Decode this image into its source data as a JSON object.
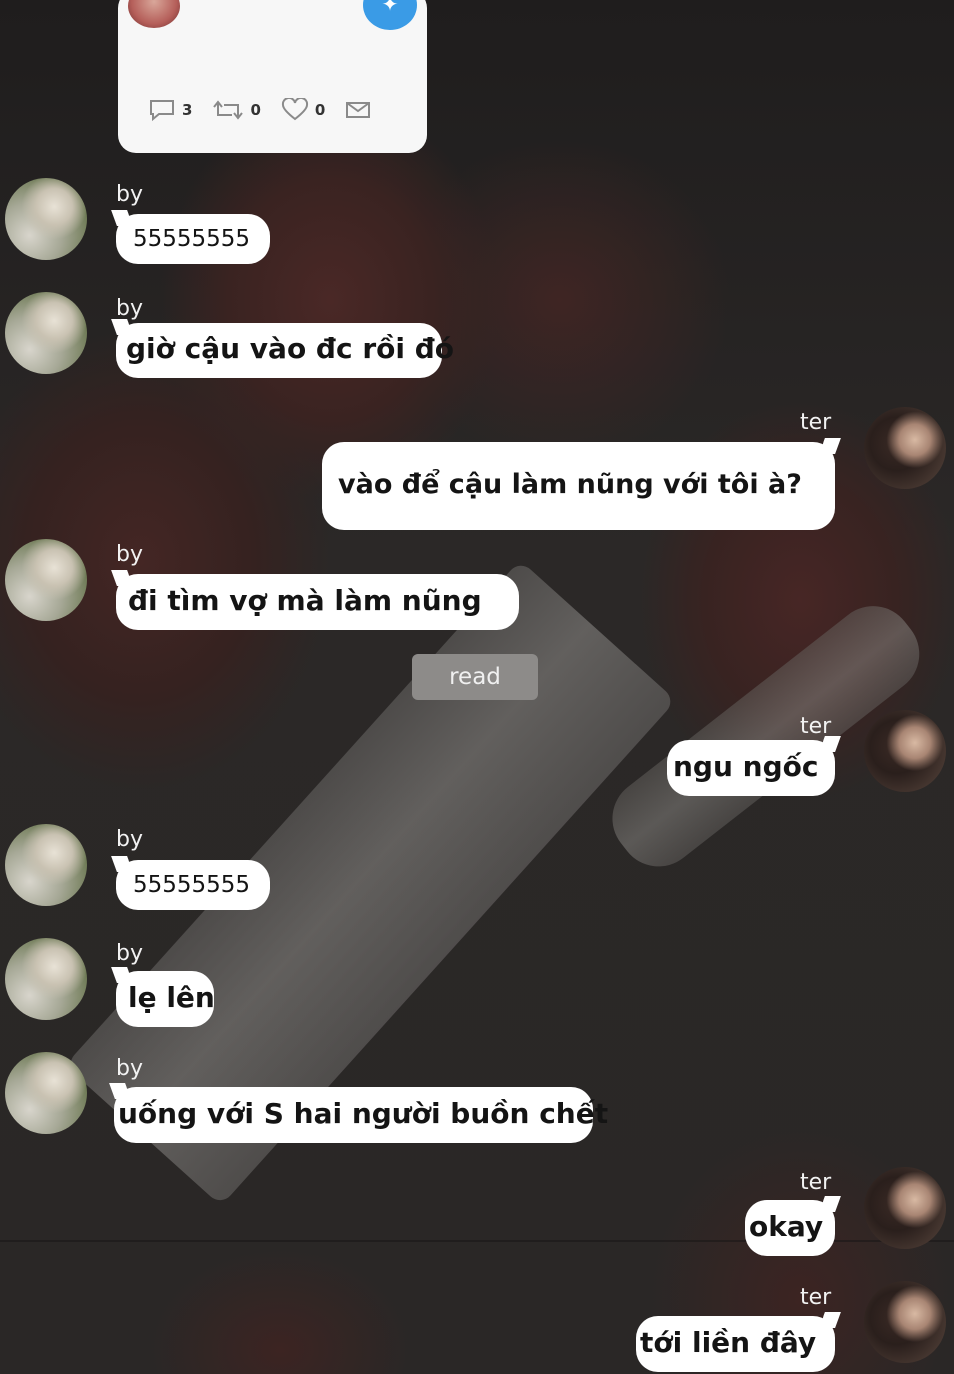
{
  "tweet_card": {
    "reply_count": "3",
    "retweet_count": "0",
    "like_count": "0"
  },
  "messages": [
    {
      "sender": "by",
      "text": "55555555"
    },
    {
      "sender": "by",
      "text": "giờ cậu vào đc rồi đó"
    },
    {
      "sender": "ter",
      "text": "vào để cậu làm nũng với tôi à?"
    },
    {
      "sender": "by",
      "text": "đi tìm vợ mà làm nũng"
    },
    {
      "sender": "ter",
      "text": "ngu ngốc"
    },
    {
      "sender": "by",
      "text": "55555555"
    },
    {
      "sender": "by",
      "text": "lẹ lên"
    },
    {
      "sender": "by",
      "text": "uống với S hai người buồn chết"
    },
    {
      "sender": "ter",
      "text": "okay"
    },
    {
      "sender": "ter",
      "text": "tới liền đây"
    }
  ],
  "read_label": "read",
  "icons": {
    "reply": "speech-bubble-icon",
    "retweet": "retweet-icon",
    "like": "heart-icon",
    "share": "envelope-icon",
    "twitter": "twitter-bird-icon"
  },
  "colors": {
    "bubble": "#ffffff",
    "name_text": "#f2f2f2",
    "read_badge": "#8d8b89",
    "twitter_blue": "#3a9be6"
  }
}
